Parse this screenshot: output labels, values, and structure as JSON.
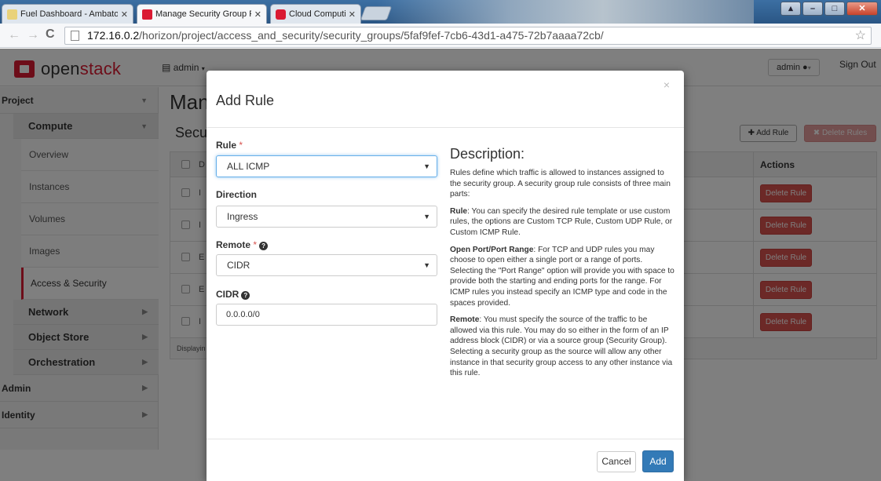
{
  "browser": {
    "tabs": [
      {
        "title": "Fuel Dashboard - Ambato",
        "favicon_color": "#e9d27a"
      },
      {
        "title": "Manage Security Group R",
        "favicon_color": "#da1a32"
      },
      {
        "title": "Cloud Computing - Open",
        "favicon_color": "#da1a32"
      }
    ],
    "url_host": "172.16.0.2",
    "url_path": "/horizon/project/access_and_security/security_groups/5faf9fef-7cb6-43d1-a475-72b7aaaa72cb/"
  },
  "header": {
    "logo_open": "open",
    "logo_stack": "stack",
    "project_selector": "admin",
    "user_menu": "admin",
    "sign_out": "Sign Out"
  },
  "sidebar": {
    "project": "Project",
    "compute": "Compute",
    "compute_items": [
      "Overview",
      "Instances",
      "Volumes",
      "Images",
      "Access & Security"
    ],
    "network": "Network",
    "object_store": "Object Store",
    "orchestration": "Orchestration",
    "admin": "Admin",
    "identity": "Identity"
  },
  "main": {
    "title_partial": "Man",
    "subtitle_partial": "Secu",
    "add_rule_button": "Add Rule",
    "delete_rules_button": "Delete Rules",
    "actions_header": "Actions",
    "row_stubs": [
      "I",
      "I",
      "E",
      "E",
      "I"
    ],
    "delete_rule_label": "Delete Rule",
    "footer_partial": "Displayin"
  },
  "modal": {
    "title": "Add Rule",
    "close": "×",
    "rule_label": "Rule",
    "rule_value": "ALL ICMP",
    "direction_label": "Direction",
    "direction_value": "Ingress",
    "remote_label": "Remote",
    "remote_value": "CIDR",
    "cidr_label": "CIDR",
    "cidr_value": "0.0.0.0/0",
    "description_heading": "Description:",
    "desc_intro": "Rules define which traffic is allowed to instances assigned to the security group. A security group rule consists of three main parts:",
    "desc_rule_term": "Rule",
    "desc_rule_text": ": You can specify the desired rule template or use custom rules, the options are Custom TCP Rule, Custom UDP Rule, or Custom ICMP Rule.",
    "desc_port_term": "Open Port/Port Range",
    "desc_port_text": ": For TCP and UDP rules you may choose to open either a single port or a range of ports. Selecting the \"Port Range\" option will provide you with space to provide both the starting and ending ports for the range. For ICMP rules you instead specify an ICMP type and code in the spaces provided.",
    "desc_remote_term": "Remote",
    "desc_remote_text": ": You must specify the source of the traffic to be allowed via this rule. You may do so either in the form of an IP address block (CIDR) or via a source group (Security Group). Selecting a security group as the source will allow any other instance in that security group access to any other instance via this rule.",
    "cancel_button": "Cancel",
    "add_button": "Add"
  },
  "colors": {
    "brand_red": "#da1a32",
    "danger": "#d9534f",
    "primary": "#337ab7"
  }
}
